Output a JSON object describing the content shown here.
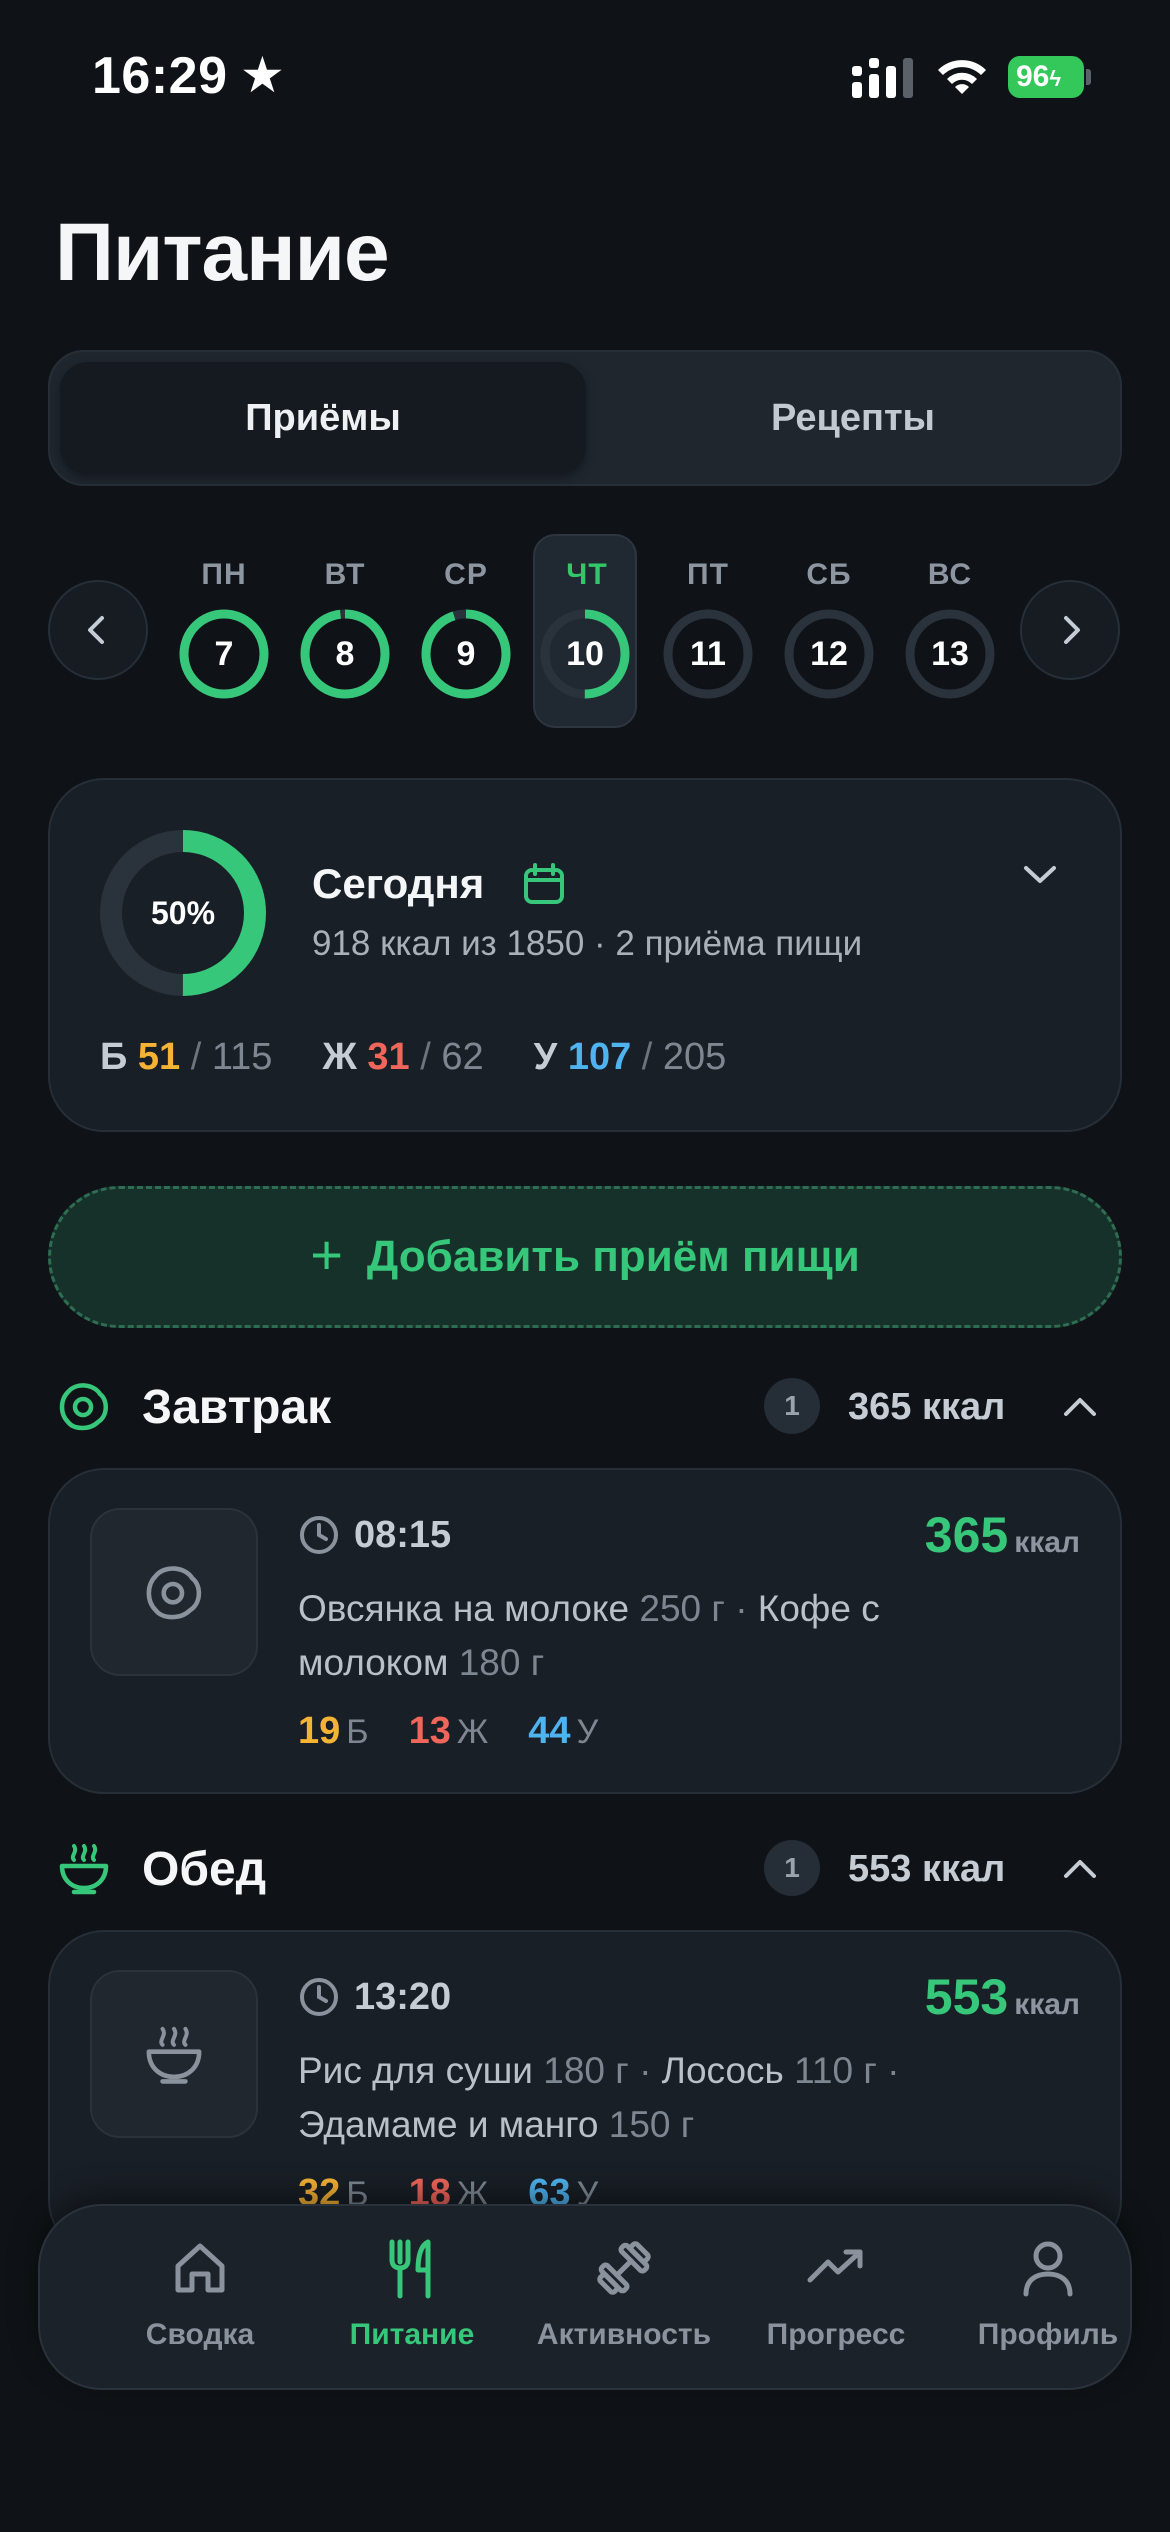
{
  "status_bar": {
    "time": "16:29",
    "battery": "96"
  },
  "page_title": "Питание",
  "segments": {
    "active": "Приёмы",
    "inactive": "Рецепты"
  },
  "week": [
    {
      "label": "ПН",
      "day": "7",
      "progress": 1.0
    },
    {
      "label": "ВТ",
      "day": "8",
      "progress": 0.98
    },
    {
      "label": "СР",
      "day": "9",
      "progress": 0.95
    },
    {
      "label": "ЧТ",
      "day": "10",
      "progress": 0.5,
      "selected": true
    },
    {
      "label": "ПТ",
      "day": "11",
      "progress": 0
    },
    {
      "label": "СБ",
      "day": "12",
      "progress": 0
    },
    {
      "label": "ВС",
      "day": "13",
      "progress": 0
    }
  ],
  "summary": {
    "percent_label": "50%",
    "progress": 0.5,
    "title": "Сегодня",
    "subtitle": "918 ккал из 1850 · 2 приёма пищи",
    "macros": {
      "protein": {
        "label": "Б",
        "value": "51",
        "max": "115"
      },
      "fat": {
        "label": "Ж",
        "value": "31",
        "max": "62"
      },
      "carbs": {
        "label": "У",
        "value": "107",
        "max": "205"
      }
    }
  },
  "add_meal_label": "Добавить приём пищи",
  "meals": [
    {
      "section_title": "Завтрак",
      "count": "1",
      "section_kcal": "365 ккал",
      "time": "08:15",
      "kcal": "365",
      "kcal_unit": "ккал",
      "items": [
        {
          "name": "Овсянка на молоке",
          "weight": "250 г"
        },
        {
          "name": "Кофе с молоком",
          "weight": "180 г"
        }
      ],
      "macros": {
        "protein": "19",
        "fat": "13",
        "carbs": "44",
        "p_unit": "Б",
        "f_unit": "Ж",
        "c_unit": "У"
      }
    },
    {
      "section_title": "Обед",
      "count": "1",
      "section_kcal": "553 ккал",
      "time": "13:20",
      "kcal": "553",
      "kcal_unit": "ккал",
      "items": [
        {
          "name": "Рис для суши",
          "weight": "180 г"
        },
        {
          "name": "Лосось",
          "weight": "110 г"
        },
        {
          "name": "Эдамаме и манго",
          "weight": "150 г"
        }
      ],
      "macros": {
        "protein": "32",
        "fat": "18",
        "carbs": "63",
        "p_unit": "Б",
        "f_unit": "Ж",
        "c_unit": "У"
      }
    }
  ],
  "tabs": [
    {
      "label": "Сводка",
      "icon": "home-icon"
    },
    {
      "label": "Питание",
      "icon": "fork-knife-icon",
      "active": true
    },
    {
      "label": "Активность",
      "icon": "dumbbell-icon"
    },
    {
      "label": "Прогресс",
      "icon": "trend-up-icon"
    },
    {
      "label": "Профиль",
      "icon": "person-icon"
    }
  ],
  "colors": {
    "accent": "#37c77a",
    "protein": "#f5b335",
    "fat": "#f0665a",
    "carbs": "#4fb3ef",
    "background": "#0f1317",
    "card": "#191f26"
  }
}
